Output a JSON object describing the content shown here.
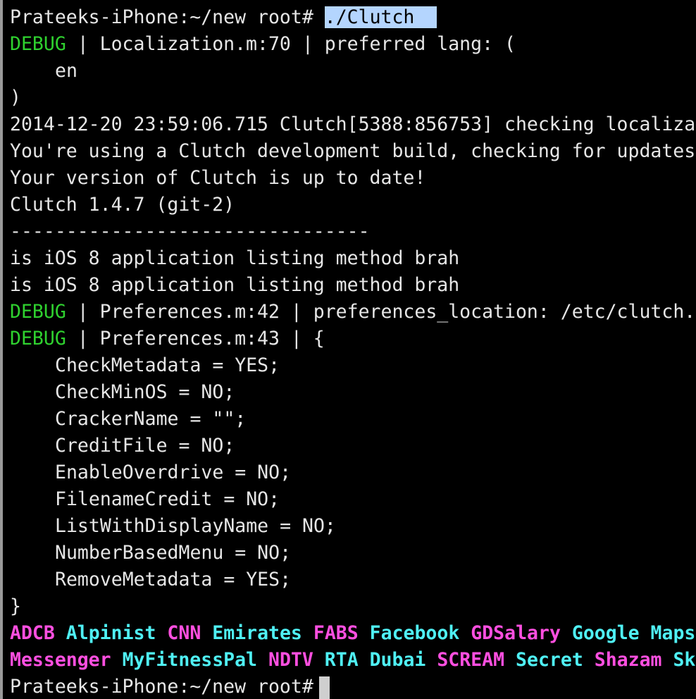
{
  "terminal": {
    "prompt": "Prateeks-iPhone:~/new root#",
    "command": "./Clutch",
    "debug_tag": "DEBUG",
    "lines": [
      " | Localization.m:70 | preferred lang: (",
      "en",
      ")",
      "2014-12-20 23:59:06.715 Clutch[5388:856753] checking localiza",
      "You're using a Clutch development build, checking for updates",
      "Your version of Clutch is up to date!",
      "Clutch 1.4.7 (git-2)",
      "--------------------------------",
      "is iOS 8 application listing method brah",
      "is iOS 8 application listing method brah",
      " | Preferences.m:42 | preferences_location: /etc/clutch.",
      " | Preferences.m:43 | {",
      "CheckMetadata = YES;",
      "CheckMinOS = NO;",
      "CrackerName = \"\";",
      "CreditFile = NO;",
      "EnableOverdrive = NO;",
      "FilenameCredit = NO;",
      "ListWithDisplayName = NO;",
      "NumberBasedMenu = NO;",
      "RemoveMetadata = YES;",
      "}"
    ],
    "apps_row1": [
      "ADCB",
      "Alpinist",
      "CNN",
      "Emirates",
      "FABS",
      "Facebook",
      "GDSalary",
      "Google Maps"
    ],
    "apps_row2": [
      "Messenger",
      "MyFitnessPal",
      "NDTV",
      "RTA Dubai",
      "SCREAM",
      "Secret",
      "Shazam",
      "Sk"
    ],
    "colors": {
      "debug": "#2fd12f",
      "app_magenta": "#ff4fe0",
      "app_cyan": "#4ff0f4",
      "selection": "#b4d5fe"
    }
  }
}
